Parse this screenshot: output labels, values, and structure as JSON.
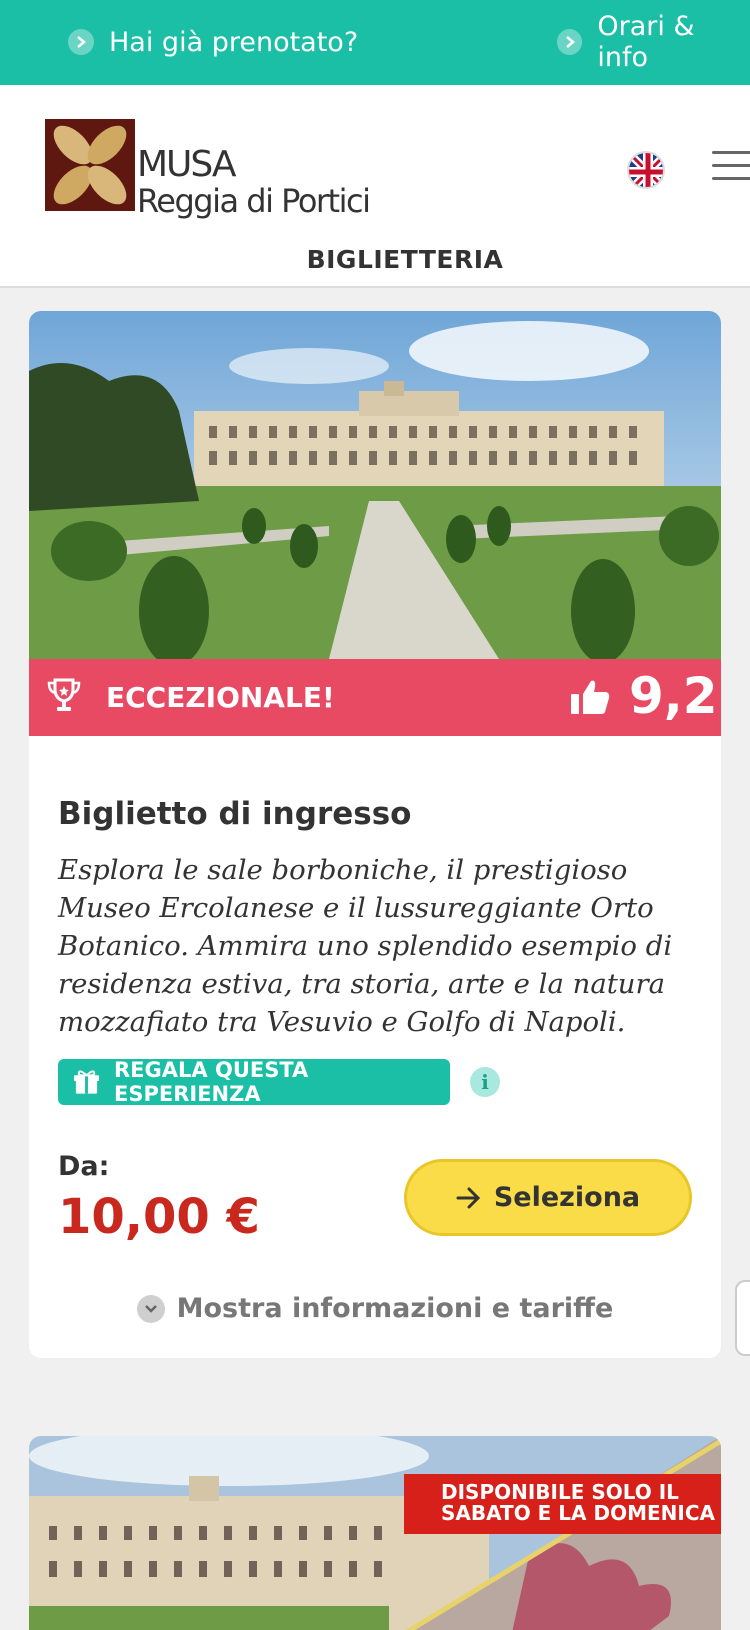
{
  "topbar": {
    "booked_link": "Hai già prenotato?",
    "hours_link": "Orari & info",
    "bg_color": "#1bbfa6"
  },
  "header": {
    "logo_line1": "MUSA",
    "logo_line2": "Reggia di Portici",
    "language_flag": "uk-flag-icon",
    "menu_icon": "hamburger-icon",
    "section_title": "BIGLIETTERIA"
  },
  "card": {
    "rating_label": "ECCEZIONALE!",
    "rating_score": "9,2",
    "rating_color": "#e84a64",
    "title": "Biglietto di ingresso",
    "description": "Esplora le sale borboniche, il prestigioso Museo Ercolanese e il lussureggiante Orto Botanico. Ammira uno splendido esempio di residenza estiva, tra storia, arte e la natura mozzafiato tra Vesuvio e Golfo di Napoli.",
    "gift_label": "REGALA QUESTA ESPERIENZA",
    "info_label": "i",
    "price_prefix": "Da:",
    "price": "10,00 €",
    "price_color": "#c8281e",
    "select_label": "Seleziona",
    "select_color": "#f9dc48",
    "more_info_label": "Mostra informazioni e tariffe"
  },
  "card2": {
    "banner_line1": "DISPONIBILE SOLO IL",
    "banner_line2": "SABATO E LA DOMENICA",
    "banner_color": "#d8201a"
  }
}
